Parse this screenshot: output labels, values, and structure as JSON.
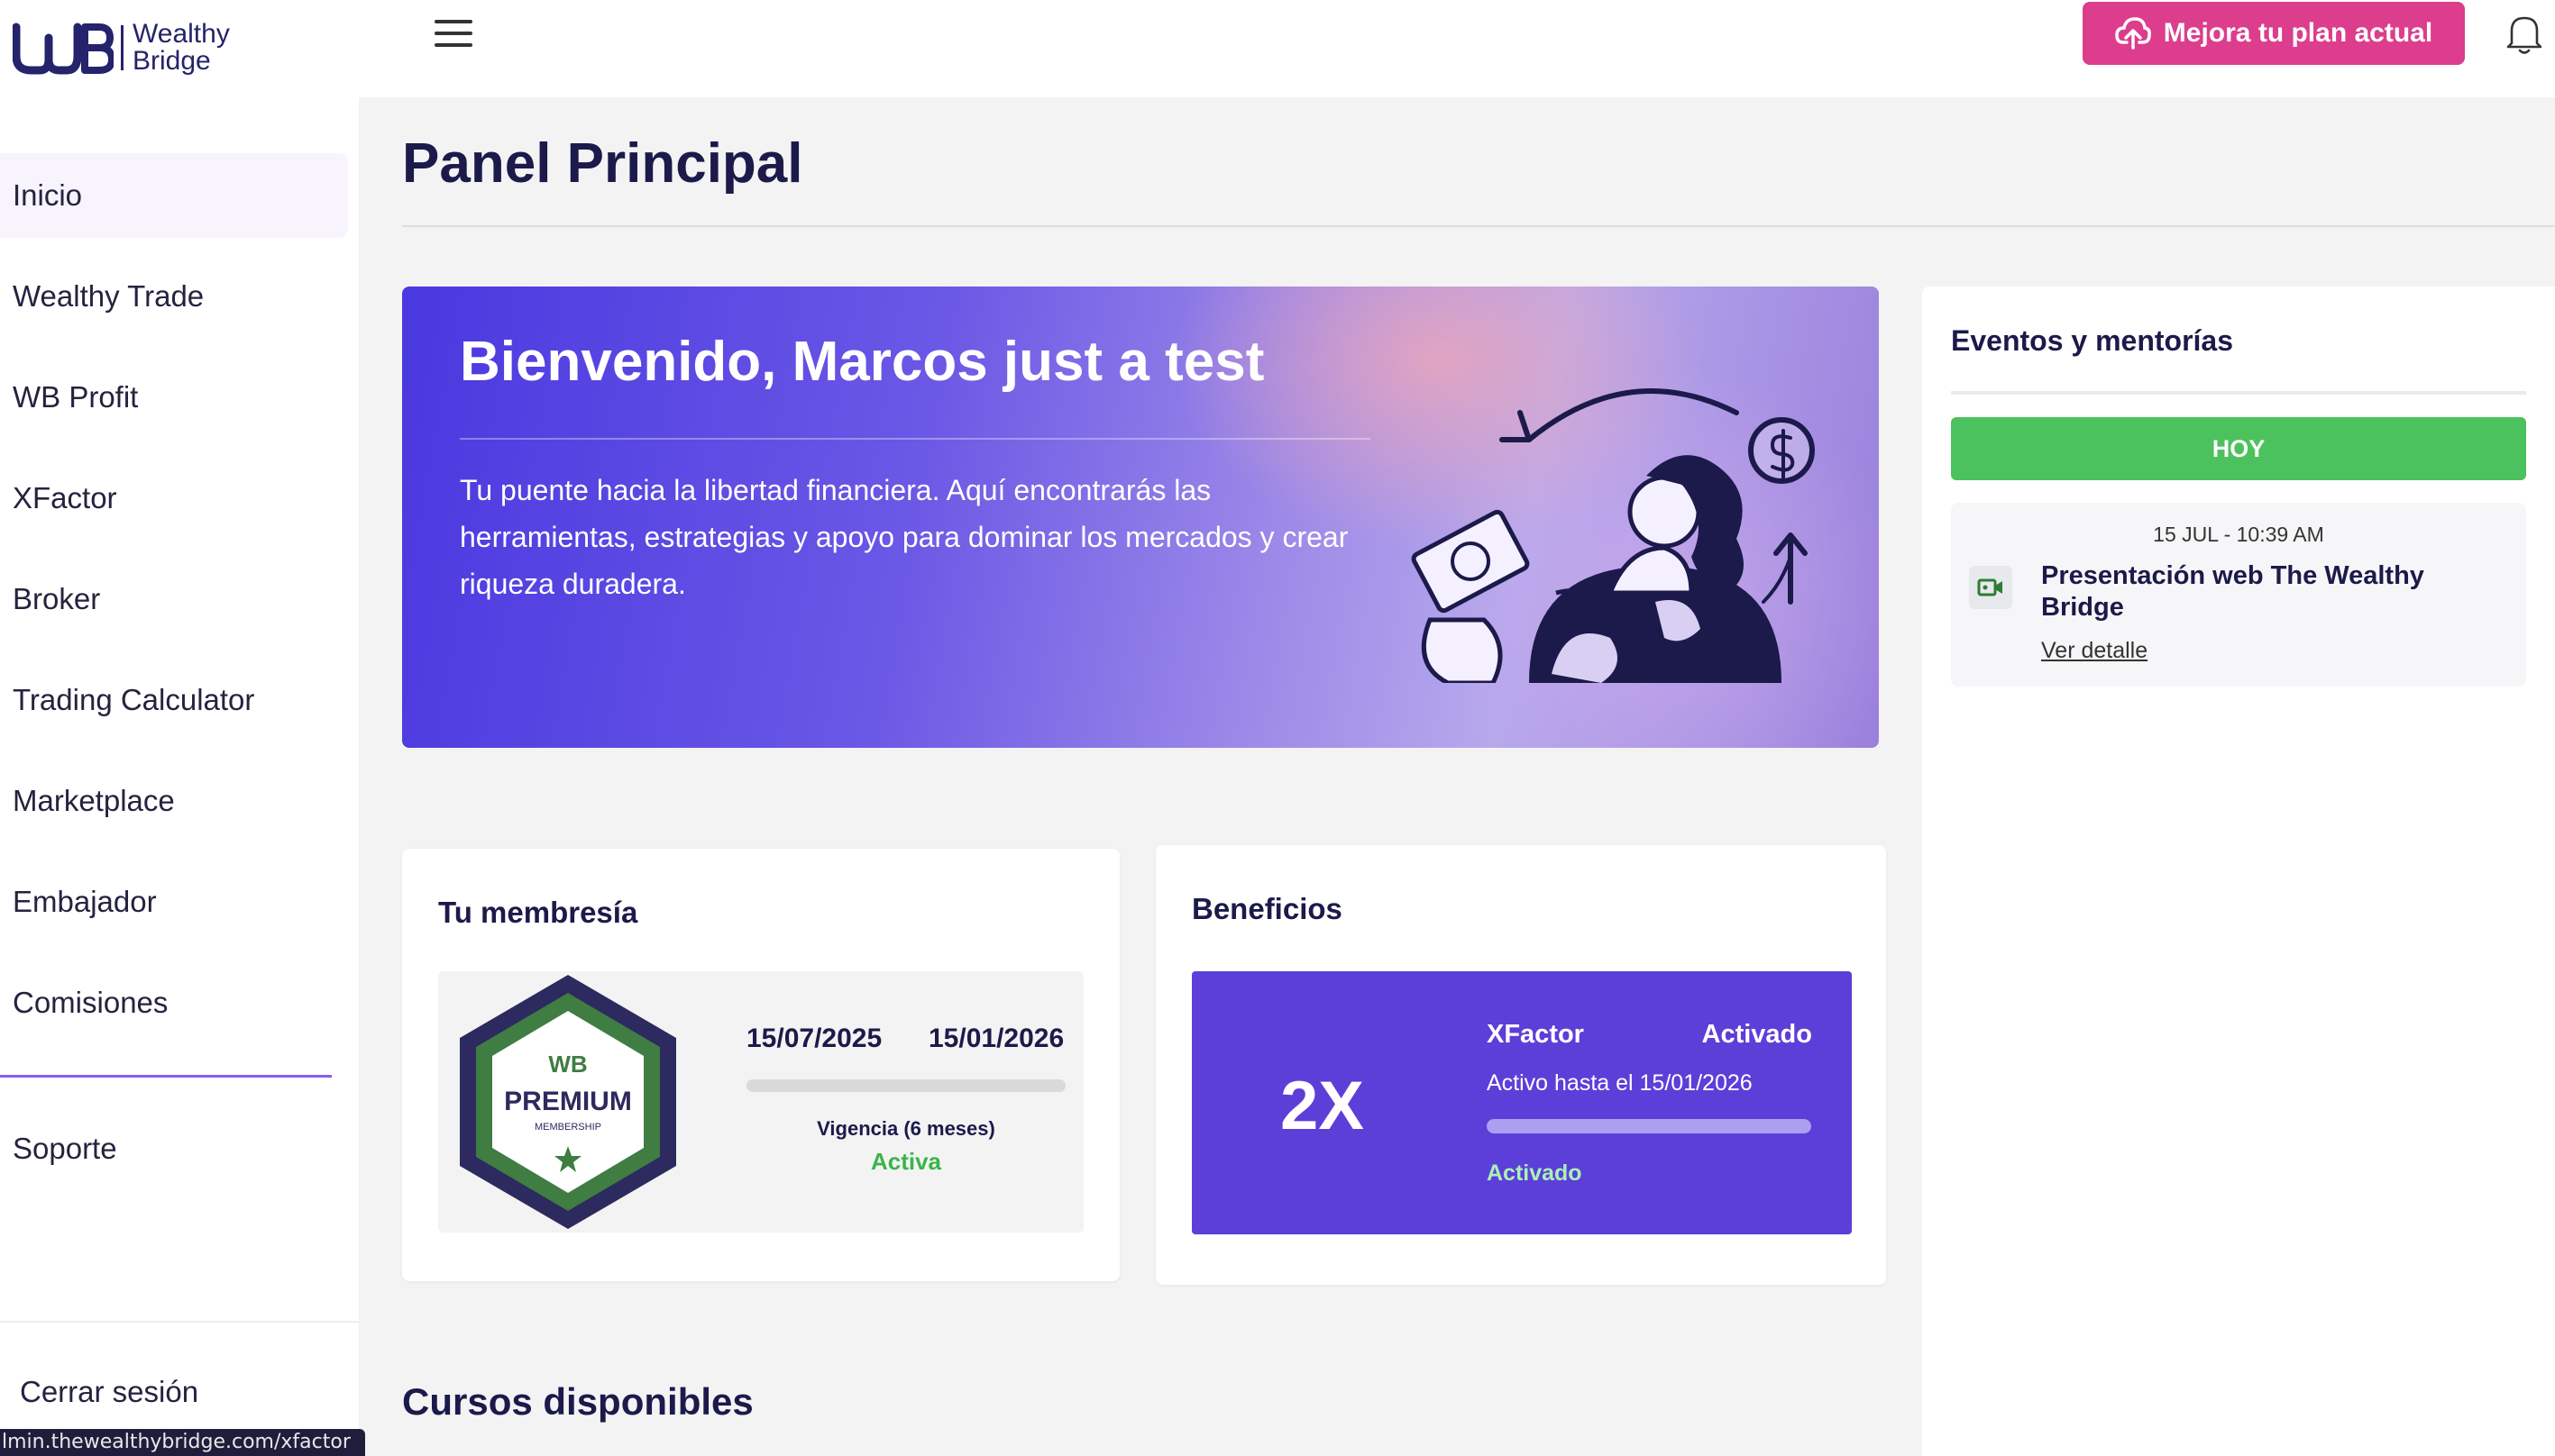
{
  "brand": {
    "logo_line1": "Wealthy",
    "logo_line2": "Bridge"
  },
  "header": {
    "upgrade_label": "Mejora tu plan actual",
    "accent_color": "#dc3d8c"
  },
  "sidebar": {
    "items": [
      {
        "label": "Inicio",
        "active": true
      },
      {
        "label": "Wealthy Trade"
      },
      {
        "label": "WB Profit"
      },
      {
        "label": "XFactor"
      },
      {
        "label": "Broker"
      },
      {
        "label": "Trading Calculator"
      },
      {
        "label": "Marketplace"
      },
      {
        "label": "Embajador"
      },
      {
        "label": "Comisiones"
      }
    ],
    "support_label": "Soporte",
    "logout_label": "Cerrar sesión"
  },
  "status_bar_url": "lmin.thewealthybridge.com/xfactor",
  "main": {
    "page_title": "Panel Principal",
    "hero": {
      "title": "Bienvenido, Marcos just a test",
      "text": "Tu puente hacia la libertad financiera. Aquí encontrarás las herramientas, estrategias y apoyo para dominar los mercados y crear riqueza duradera."
    },
    "membership": {
      "title": "Tu membresía",
      "badge_brand": "WB",
      "badge_title": "PREMIUM",
      "badge_subtitle": "MEMBERSHIP",
      "start_date": "15/07/2025",
      "end_date": "15/01/2026",
      "validity": "Vigencia (6 meses)",
      "status": "Activa"
    },
    "benefits": {
      "title": "Beneficios",
      "multiplier": "2X",
      "name": "XFactor",
      "state": "Activado",
      "until": "Activo hasta el 15/01/2026",
      "status": "Activado",
      "color": "#5c3fd8"
    },
    "courses_title": "Cursos disponibles"
  },
  "events": {
    "title": "Eventos y mentorías",
    "today_label": "HOY",
    "today_color": "#4cc25e",
    "items": [
      {
        "time": "15 JUL - 10:39 AM",
        "name": "Presentación web The Wealthy Bridge",
        "link": "Ver detalle",
        "icon": "video-camera-icon"
      }
    ]
  }
}
